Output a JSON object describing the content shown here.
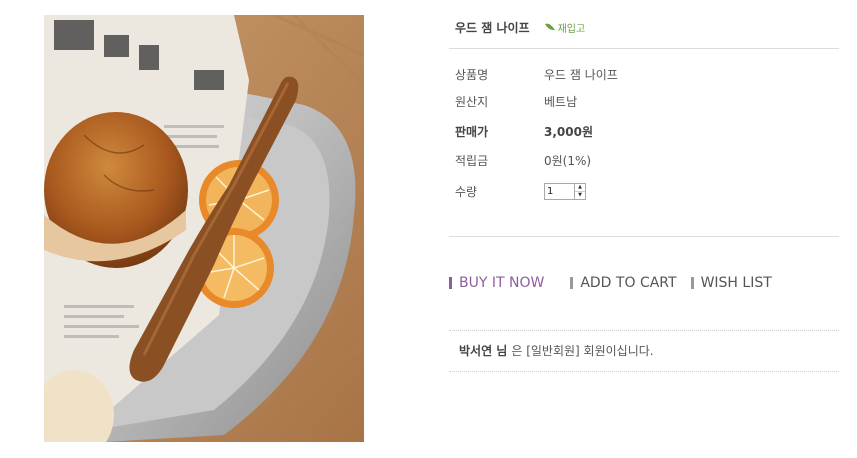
{
  "product": {
    "image_alt": "wood jam knife product photo",
    "title": "우드 잼 나이프",
    "restock_badge": "재입고"
  },
  "details": [
    {
      "label": "상품명",
      "value": "우드 잼 나이프"
    },
    {
      "label": "원산지",
      "value": "베트남"
    },
    {
      "label": "판매가",
      "value": "3,000원"
    },
    {
      "label": "적립금",
      "value": "0원(1%)"
    }
  ],
  "quantity": {
    "label": "수량",
    "value": "1"
  },
  "actions": {
    "buy_now": "BUY IT NOW",
    "add_to_cart": "ADD TO CART",
    "wish_list": "WISH LIST"
  },
  "member": {
    "name": "박서연 님",
    "message": "은 [일반회원] 회원이십니다."
  },
  "colors": {
    "buy_accent": "#8e5e9c",
    "restock_green": "#6aa33a"
  }
}
